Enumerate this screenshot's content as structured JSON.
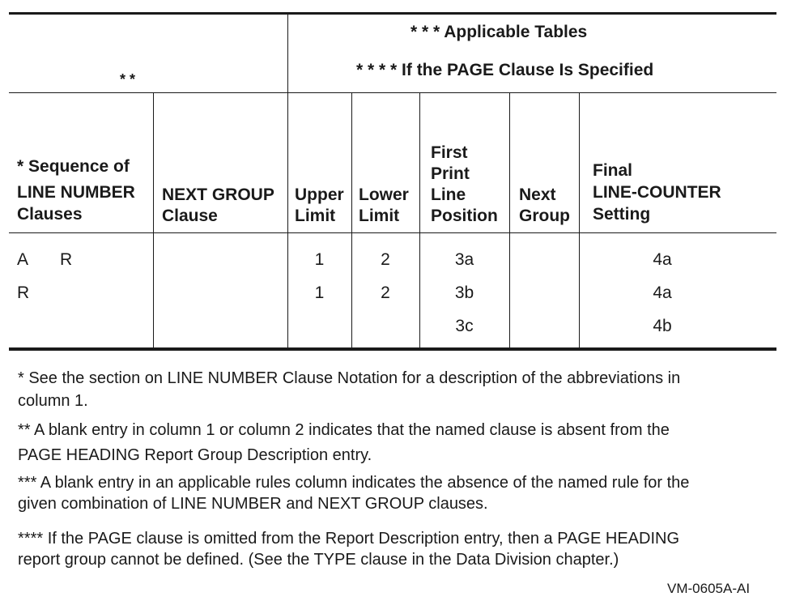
{
  "table": {
    "top_left_marker": "* *",
    "applicable_tables_heading": "* * * Applicable Tables",
    "page_clause_heading": "* * * * If the PAGE Clause Is Specified",
    "columns": [
      {
        "lines": [
          "* Sequence of",
          "LINE NUMBER",
          "Clauses"
        ]
      },
      {
        "lines": [
          "NEXT GROUP",
          "Clause"
        ]
      },
      {
        "lines": [
          "Upper",
          "Limit"
        ]
      },
      {
        "lines": [
          "Lower",
          "Limit"
        ]
      },
      {
        "lines": [
          "First",
          "Print",
          "Line",
          "Position"
        ]
      },
      {
        "lines": [
          "Next",
          "Group"
        ]
      },
      {
        "lines": [
          "Final",
          "LINE-COUNTER",
          "Setting"
        ]
      }
    ],
    "rows": [
      {
        "seq_a": "A",
        "seq_b": "R",
        "next_group": "",
        "upper": "1",
        "lower": "2",
        "first_print": "3a",
        "next": "",
        "final": "4a"
      },
      {
        "seq_a": "R",
        "seq_b": "",
        "next_group": "",
        "upper": "1",
        "lower": "2",
        "first_print": "3b",
        "next": "",
        "final": "4a"
      },
      {
        "seq_a": "",
        "seq_b": "",
        "next_group": "",
        "upper": "",
        "lower": "",
        "first_print": "3c",
        "next": "",
        "final": "4b"
      }
    ]
  },
  "notes": [
    {
      "line1": "* See the section on LINE NUMBER Clause Notation for a description of the abbreviations in",
      "line2": "column 1."
    },
    {
      "line1": "** A blank entry in column 1 or column 2 indicates that the named clause is absent from the",
      "line2": "PAGE HEADING Report Group Description entry."
    },
    {
      "line1": "*** A blank entry in an applicable rules column indicates the absence of the named rule for the",
      "line2": "given combination of LINE NUMBER and NEXT GROUP clauses."
    },
    {
      "line1": "**** If the PAGE clause is omitted from the Report Description entry, then a PAGE HEADING",
      "line2": "report group cannot be defined.  (See the TYPE clause in the Data Division chapter.)"
    }
  ],
  "figure_id": "VM-0605A-AI"
}
